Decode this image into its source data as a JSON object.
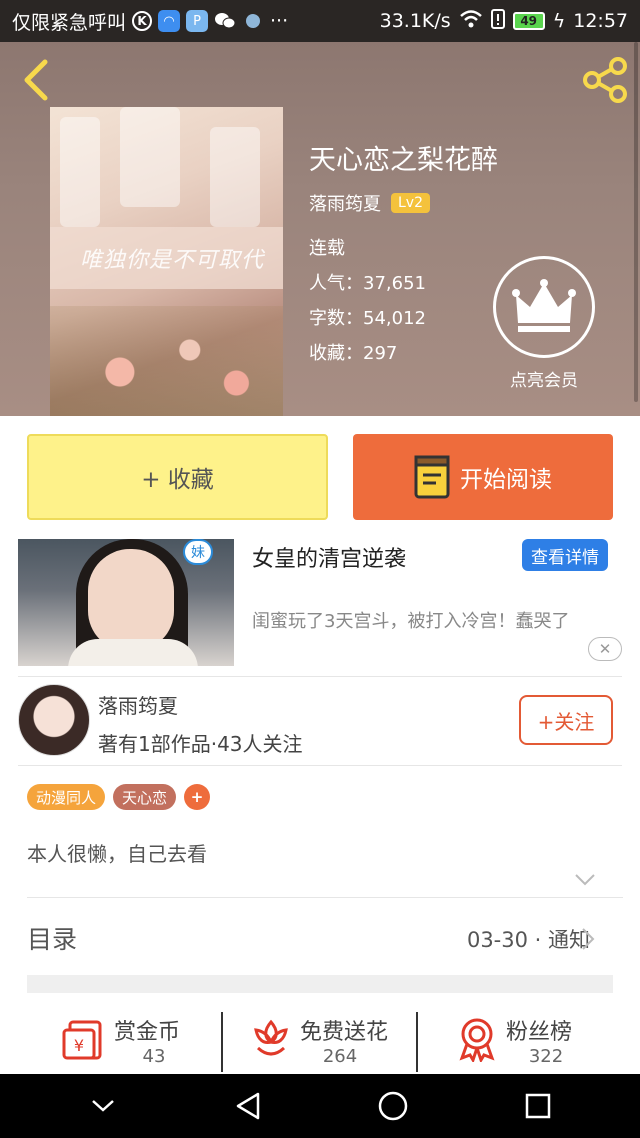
{
  "status_bar": {
    "carrier_text": "仅限紧急呼叫",
    "net_speed": "33.1K/s",
    "battery": "49",
    "time": "12:57"
  },
  "book": {
    "title": "天心恋之梨花醉",
    "cover_script": "唯独你是不可取代",
    "author": "落雨筠夏",
    "level": "Lv2",
    "status": "连载",
    "popularity": "人气：37,651",
    "word_count": "字数：54,012",
    "favorites": "收藏：297",
    "vip_label": "点亮会员"
  },
  "actions": {
    "collect_label": "+ 收藏",
    "read_label": "开始阅读"
  },
  "ad": {
    "image_tag": "妹",
    "title": "女皇的清宫逆袭",
    "detail_button": "查看详情",
    "description": "闺蜜玩了3天宫斗，被打入冷宫！蠢哭了",
    "close": "✕"
  },
  "author_card": {
    "name": "落雨筠夏",
    "stats": "著有1部作品·43人关注",
    "follow_label": "+关注"
  },
  "tags": [
    "动漫同人",
    "天心恋",
    "+"
  ],
  "intro": "本人很懒，自己去看",
  "toc": {
    "label": "目录",
    "update": "03-30 · 通知"
  },
  "bottom_stats": [
    {
      "label": "赏金币",
      "value": "43",
      "icon": "reward-coin-icon"
    },
    {
      "label": "免费送花",
      "value": "264",
      "icon": "flower-icon"
    },
    {
      "label": "粉丝榜",
      "value": "322",
      "icon": "medal-icon"
    }
  ],
  "colors": {
    "accent_orange": "#ee6c3c",
    "collect_yellow": "#fef28a",
    "level_badge": "#f4c23c",
    "ad_button_blue": "#2e7fe6"
  }
}
